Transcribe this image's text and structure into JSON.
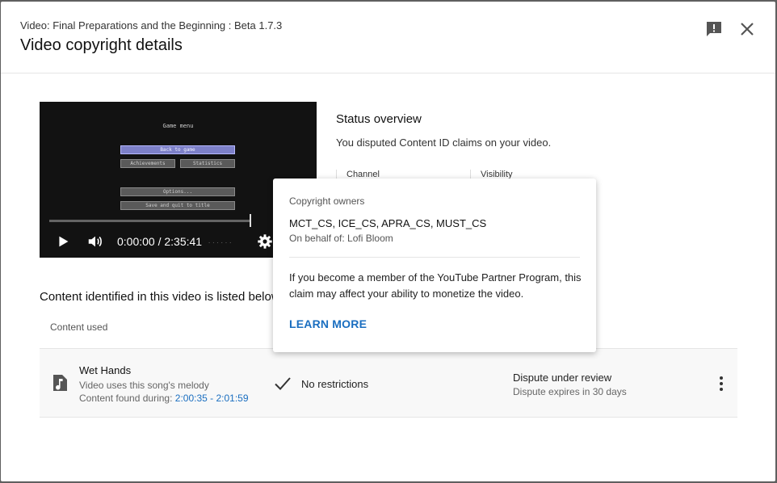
{
  "header": {
    "subtitle": "Video: Final Preparations and the Beginning : Beta 1.7.3",
    "title": "Video copyright details"
  },
  "player": {
    "menu_title": "Game menu",
    "buttons": {
      "back": "Back to game",
      "achievements": "Achievements",
      "statistics": "Statistics",
      "options": "Options...",
      "save_quit": "Save and quit to title"
    },
    "time": "0:00:00 / 2:35:41",
    "dots": "......"
  },
  "status": {
    "title": "Status overview",
    "text": "You disputed Content ID claims on your video.",
    "col_channel": "Channel",
    "col_visibility": "Visibility"
  },
  "content": {
    "heading": "Content identified in this video is listed below",
    "col_content_used": "Content used",
    "row": {
      "title": "Wet Hands",
      "subtitle": "Video uses this song's melody",
      "found_prefix": "Content found during: ",
      "found_range": "2:00:35 - 2:01:59",
      "restriction": "No restrictions",
      "dispute": "Dispute under review",
      "dispute_sub": "Dispute expires in 30 days"
    }
  },
  "popup": {
    "label": "Copyright owners",
    "owners": "MCT_CS, ICE_CS, APRA_CS, MUST_CS",
    "behalf": "On behalf of: Lofi Bloom",
    "text": "If you become a member of the YouTube Partner Program, this claim may affect your ability to monetize the video.",
    "link": "LEARN MORE"
  },
  "colors": {
    "link": "#1a6ec0",
    "row_bg": "#f8f8f8",
    "highlight_button": "#7d80c8"
  },
  "icons": [
    "feedback-icon",
    "close-icon",
    "play-icon",
    "volume-icon",
    "settings-icon",
    "music-note-icon",
    "check-icon",
    "more-vert-icon"
  ]
}
